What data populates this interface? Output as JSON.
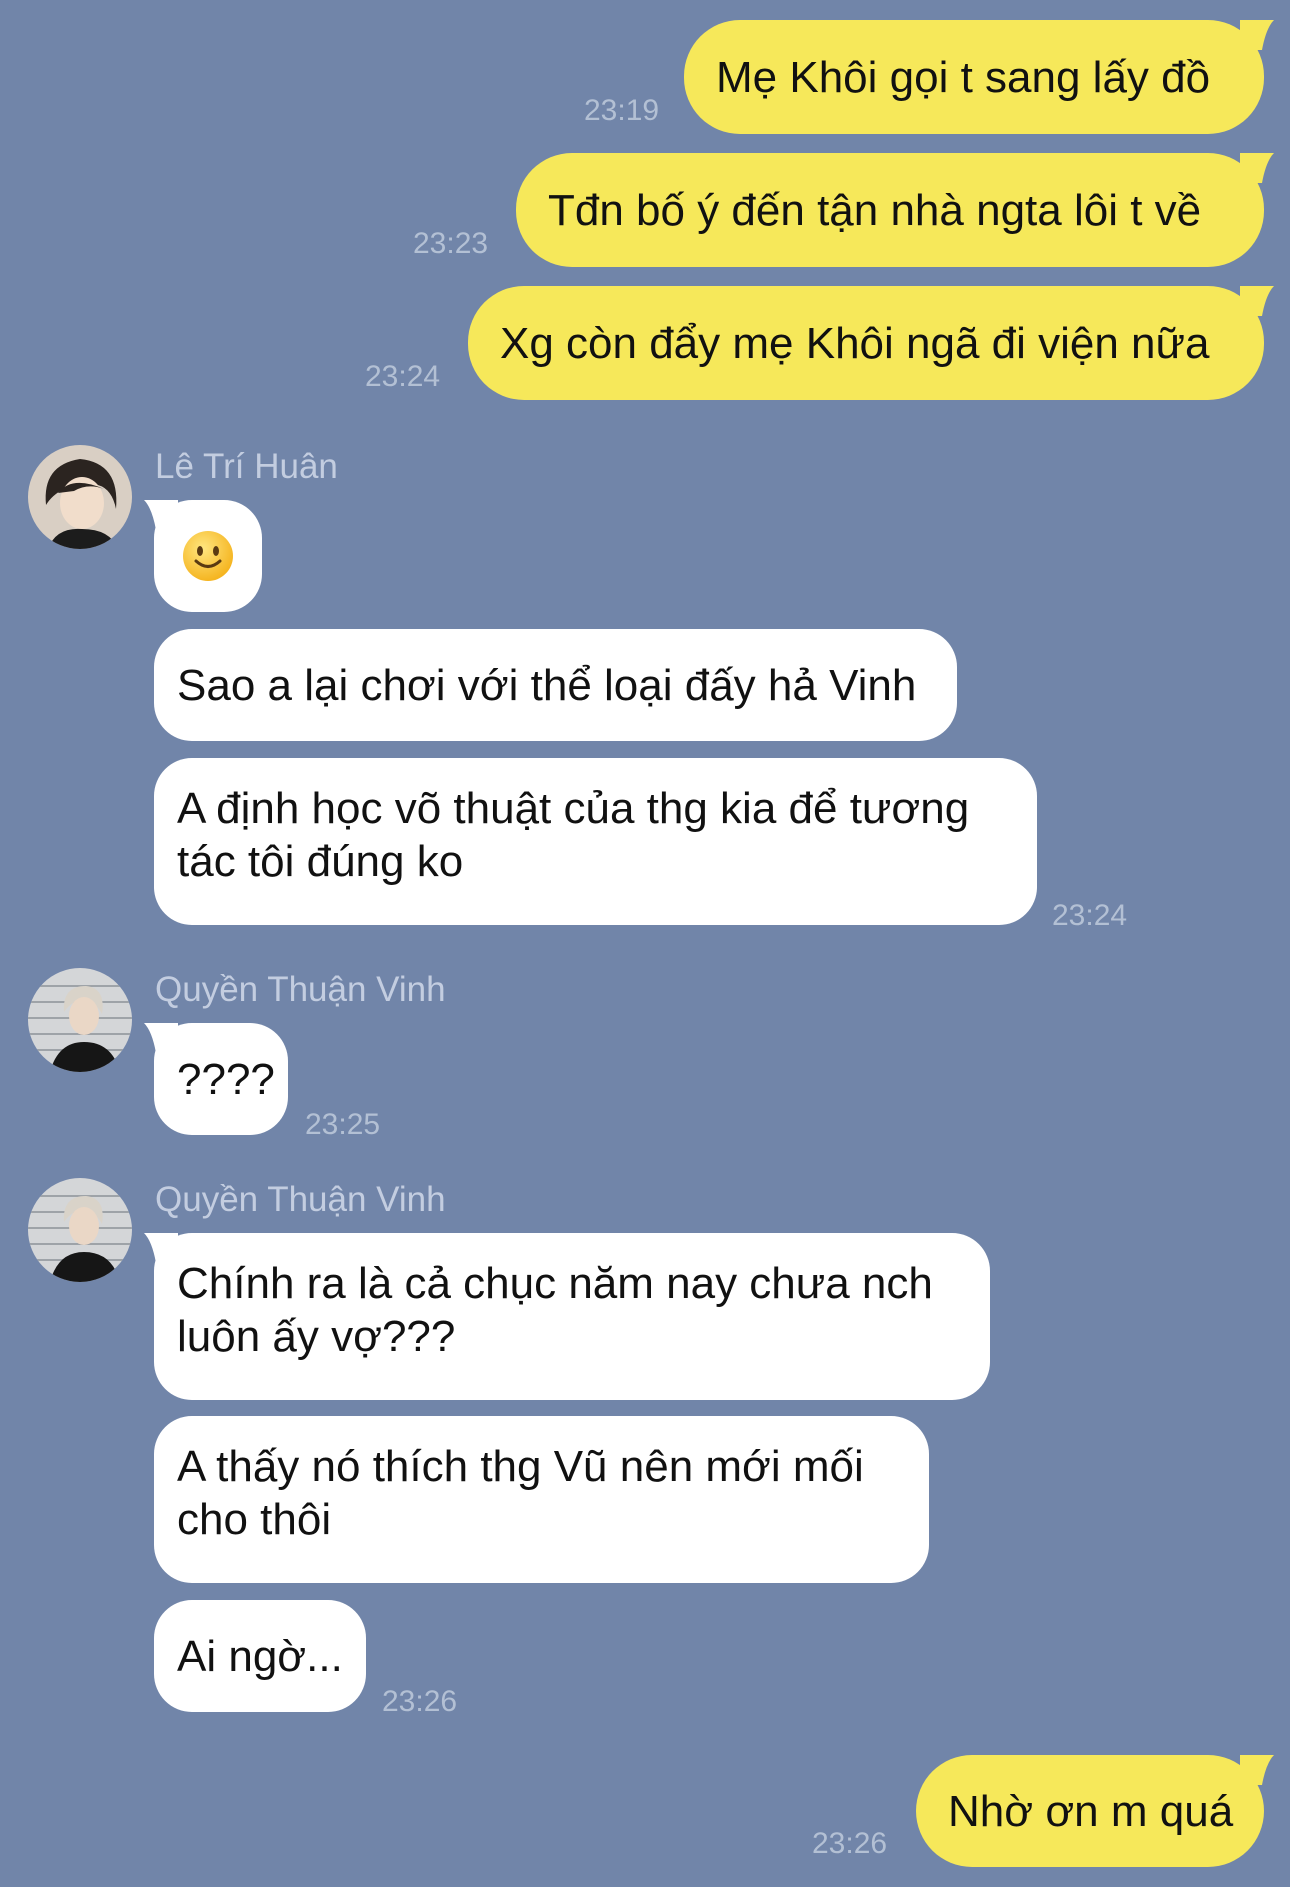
{
  "colors": {
    "background": "#7185a9",
    "sent_bubble": "#f6e85a",
    "received_bubble": "#ffffff",
    "timestamp": "#b3c0d4"
  },
  "messages": [
    {
      "id": "m1",
      "side": "sent",
      "text": "Mẹ Khôi gọi t sang lấy đồ",
      "time": "23:19"
    },
    {
      "id": "m2",
      "side": "sent",
      "text": "Tđn bố ý đến tận nhà ngta lôi t về",
      "time": "23:23"
    },
    {
      "id": "m3",
      "side": "sent",
      "text": "Xg còn đẩy mẹ Khôi ngã đi viện nữa",
      "time": "23:24"
    }
  ],
  "group1": {
    "sender": "Lê Trí Huân",
    "avatar_icon": "user-avatar-huan",
    "sticker_icon": "slightly-smiling-face-emoji",
    "msg2": "Sao a lại chơi với thể loại đấy hả Vinh",
    "msg3": "A định học võ thuật của thg kia để tương tác tôi đúng ko",
    "time": "23:24"
  },
  "group2": {
    "sender": "Quyền Thuận Vinh",
    "avatar_icon": "user-avatar-vinh",
    "msg1": "????",
    "time": "23:25"
  },
  "group3": {
    "sender": "Quyền Thuận Vinh",
    "avatar_icon": "user-avatar-vinh",
    "msg1": "Chính ra là cả chục năm nay chưa nch luôn ấy vợ???",
    "msg2": "A thấy nó thích thg Vũ nên mới mối cho thôi",
    "msg3": "Ai ngờ...",
    "time": "23:26"
  },
  "last": {
    "text": "Nhờ ơn m quá",
    "time": "23:26"
  }
}
